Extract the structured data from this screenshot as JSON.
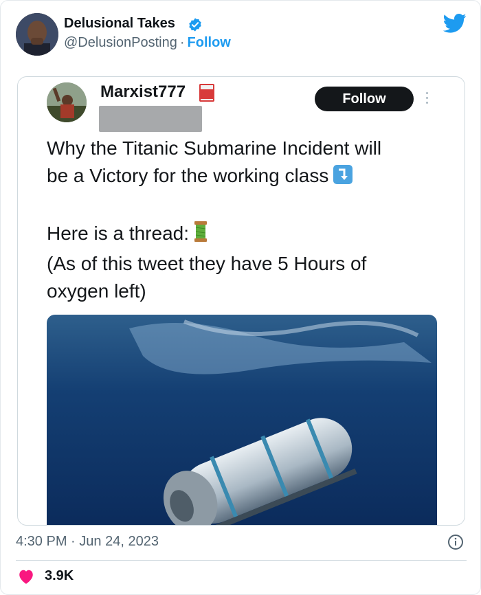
{
  "author": {
    "name": "Delusional Takes",
    "handle": "@DelusionPosting",
    "separator": "·",
    "follow_label": "Follow"
  },
  "embedded": {
    "name": "Marxist777",
    "follow_label": "Follow",
    "lines": [
      "Why the Titanic Submarine Incident will",
      "be a Victory for the working class"
    ],
    "thread_line": "Here is a thread:",
    "oxygen_lines": [
      "(As of this tweet they have 5 Hours of",
      "oxygen left)"
    ]
  },
  "footer": {
    "time": "4:30 PM",
    "separator": "·",
    "date": "Jun 24, 2023",
    "likes": "3.9K"
  },
  "icons": {
    "verified": "verified-badge-icon",
    "brand": "twitter-bird-icon",
    "book": "closed-book-emoji-icon",
    "arrow": "down-arrow-emoji-icon",
    "spool": "thread-spool-emoji-icon",
    "info": "info-icon",
    "heart": "heart-icon"
  },
  "colors": {
    "brand_blue": "#1d9bf0",
    "heart_pink": "#f91880",
    "text_gray": "#536471"
  }
}
